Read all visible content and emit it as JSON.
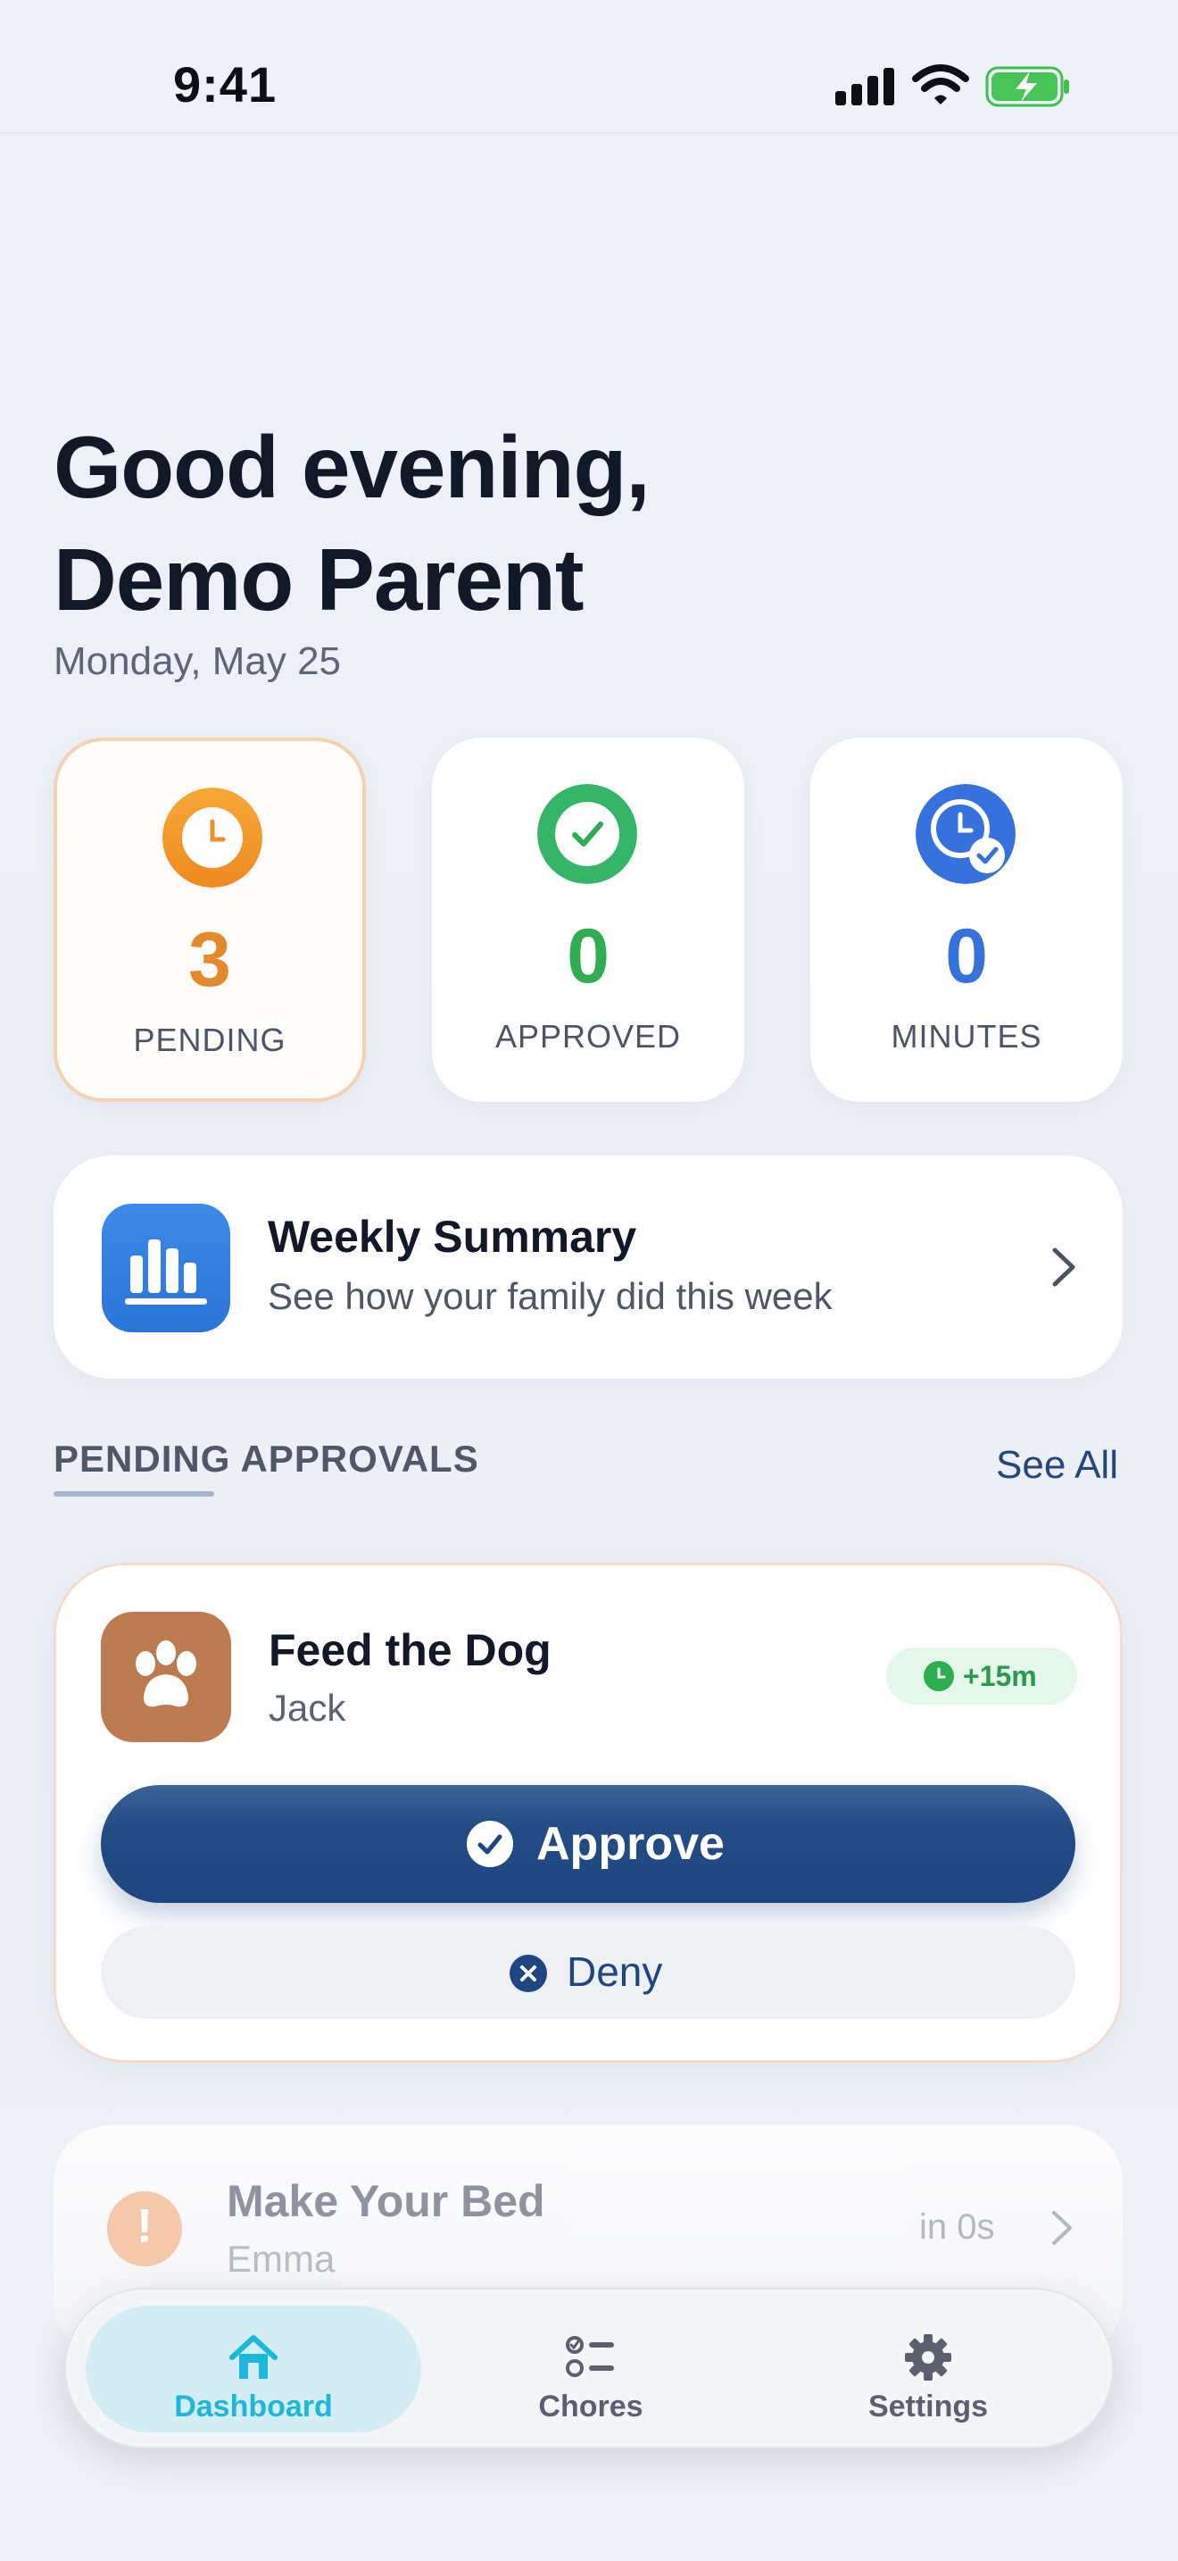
{
  "status_bar": {
    "time": "9:41"
  },
  "greeting": {
    "line1": "Good evening,",
    "line2": "Demo Parent",
    "date": "Monday, May 25"
  },
  "stats": [
    {
      "value": "3",
      "label": "PENDING",
      "icon": "clock-icon",
      "color": "#e58a2a"
    },
    {
      "value": "0",
      "label": "APPROVED",
      "icon": "check-circle-icon",
      "color": "#2ead52"
    },
    {
      "value": "0",
      "label": "MINUTES",
      "icon": "clock-check-icon",
      "color": "#3771de"
    }
  ],
  "weekly_summary": {
    "title": "Weekly Summary",
    "subtitle": "See how your family did this week",
    "icon": "bar-chart-icon"
  },
  "pending_section": {
    "title": "PENDING APPROVALS",
    "see_all": "See All"
  },
  "approval": {
    "chore": "Feed the Dog",
    "kid": "Jack",
    "reward": "+15m",
    "icon": "paw-icon",
    "approve_label": "Approve",
    "deny_label": "Deny"
  },
  "next_item": {
    "chore": "Make Your Bed",
    "kid": "Emma",
    "time": "in 0s",
    "icon": "alert-icon"
  },
  "tabs": [
    {
      "label": "Dashboard",
      "icon": "home-icon",
      "active": true
    },
    {
      "label": "Chores",
      "icon": "list-icon",
      "active": false
    },
    {
      "label": "Settings",
      "icon": "gear-icon",
      "active": false
    }
  ],
  "colors": {
    "accent": "#1f4680",
    "tab_active": "#1ab8dc",
    "pending": "#e58a2a",
    "approved": "#2ead52",
    "minutes": "#3771de"
  }
}
